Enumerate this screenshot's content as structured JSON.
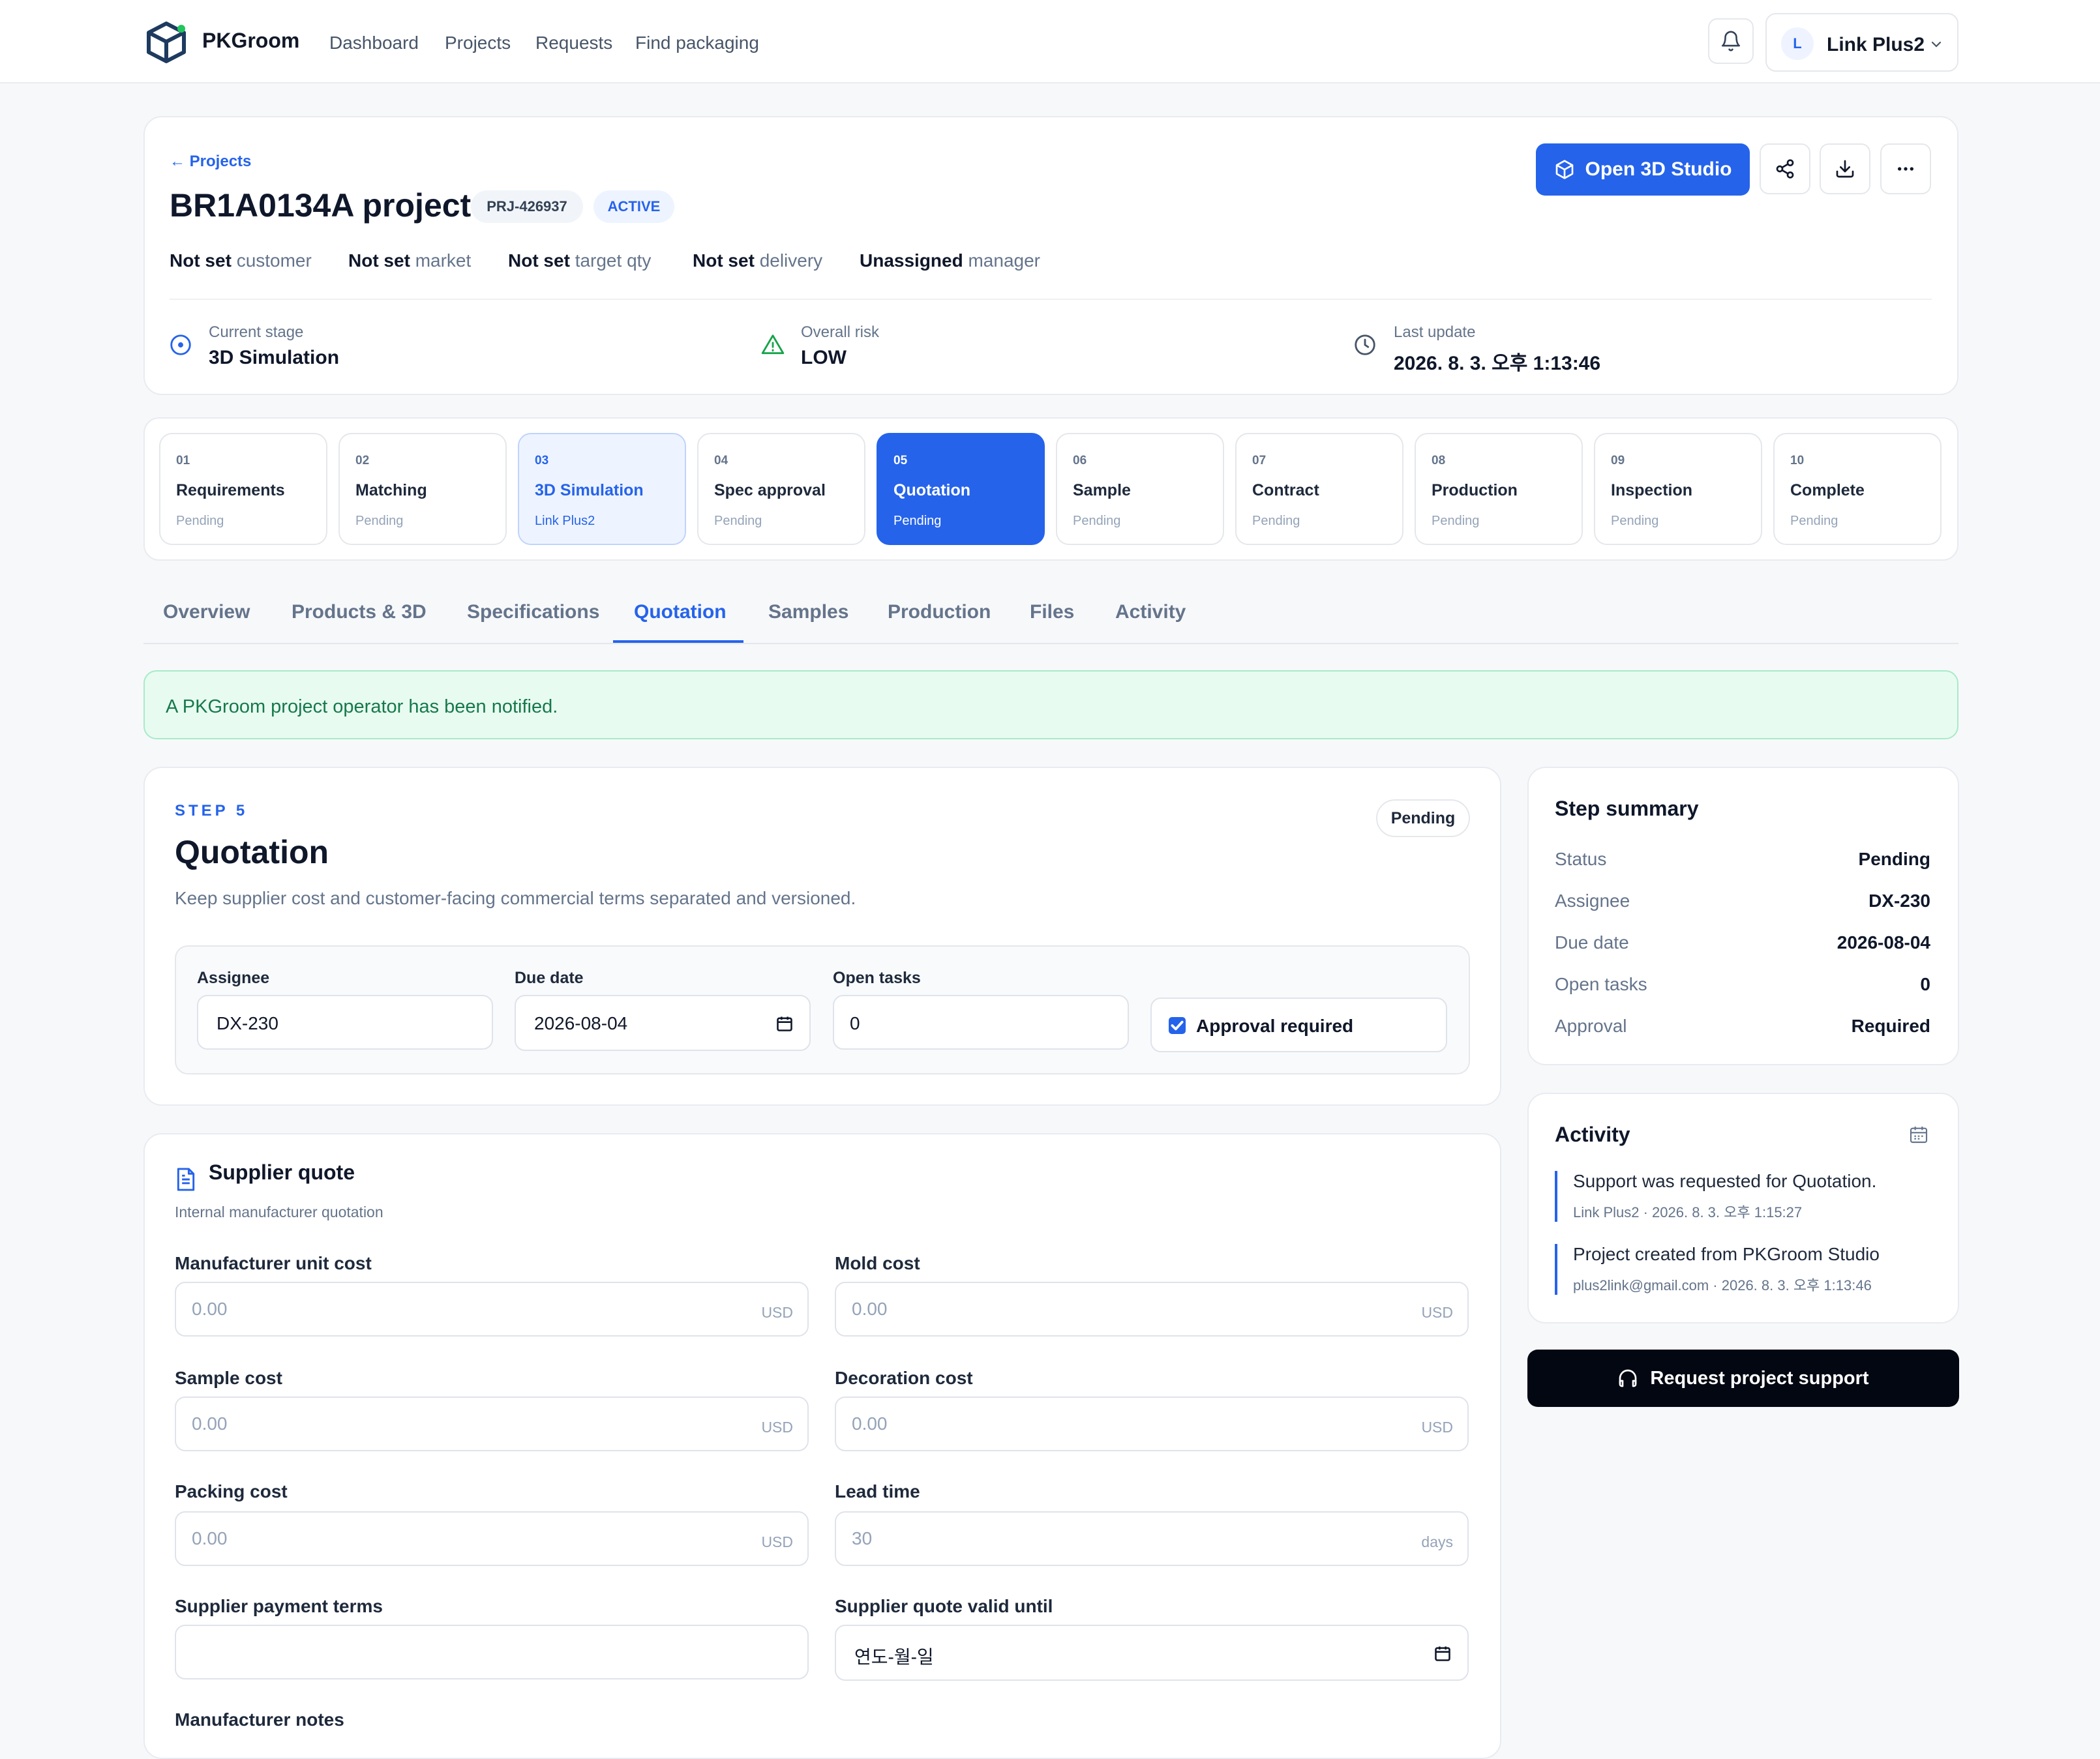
{
  "app": {
    "brand": "PKGroom"
  },
  "nav": {
    "items": [
      "Dashboard",
      "Projects",
      "Requests",
      "Find packaging"
    ]
  },
  "user": {
    "initial": "L",
    "name": "Link Plus2"
  },
  "project": {
    "back_label": "← Projects",
    "title": "BR1A0134A project",
    "code": "PRJ-426937",
    "status": "ACTIVE",
    "open_studio_label": "Open 3D Studio",
    "meta": [
      {
        "value": "Not set",
        "label": "customer"
      },
      {
        "value": "Not set",
        "label": "market"
      },
      {
        "value": "Not set",
        "label": "target qty"
      },
      {
        "value": "Not set",
        "label": "delivery"
      },
      {
        "value": "Unassigned",
        "label": "manager"
      }
    ],
    "stats": [
      {
        "label": "Current stage",
        "value": "3D Simulation"
      },
      {
        "label": "Overall risk",
        "value": "LOW"
      },
      {
        "label": "Last update",
        "value": "2026. 8. 3. 오후 1:13:46"
      }
    ]
  },
  "steps": [
    {
      "num": "01",
      "title": "Requirements",
      "status": "Pending"
    },
    {
      "num": "02",
      "title": "Matching",
      "status": "Pending"
    },
    {
      "num": "03",
      "title": "3D Simulation",
      "status": "Link Plus2"
    },
    {
      "num": "04",
      "title": "Spec approval",
      "status": "Pending"
    },
    {
      "num": "05",
      "title": "Quotation",
      "status": "Pending"
    },
    {
      "num": "06",
      "title": "Sample",
      "status": "Pending"
    },
    {
      "num": "07",
      "title": "Contract",
      "status": "Pending"
    },
    {
      "num": "08",
      "title": "Production",
      "status": "Pending"
    },
    {
      "num": "09",
      "title": "Inspection",
      "status": "Pending"
    },
    {
      "num": "10",
      "title": "Complete",
      "status": "Pending"
    }
  ],
  "tabs": [
    "Overview",
    "Products & 3D",
    "Specifications",
    "Quotation",
    "Samples",
    "Production",
    "Files",
    "Activity"
  ],
  "alert": "A PKGroom project operator has been notified.",
  "step_panel": {
    "eyebrow": "STEP 5",
    "title": "Quotation",
    "status": "Pending",
    "description": "Keep supplier cost and customer-facing commercial terms separated and versioned.",
    "assignee_label": "Assignee",
    "assignee": "DX-230",
    "due_label": "Due date",
    "due": "2026-08-04",
    "tasks_label": "Open tasks",
    "tasks": "0",
    "approval_label": "Approval required",
    "approval_checked": true
  },
  "supplier": {
    "title": "Supplier quote",
    "subtitle": "Internal manufacturer quotation",
    "fields": [
      {
        "label": "Manufacturer unit cost",
        "placeholder": "0.00",
        "unit": "USD"
      },
      {
        "label": "Mold cost",
        "placeholder": "0.00",
        "unit": "USD"
      },
      {
        "label": "Sample cost",
        "placeholder": "0.00",
        "unit": "USD"
      },
      {
        "label": "Decoration cost",
        "placeholder": "0.00",
        "unit": "USD"
      },
      {
        "label": "Packing cost",
        "placeholder": "0.00",
        "unit": "USD"
      },
      {
        "label": "Lead time",
        "placeholder": "30",
        "unit": "days"
      },
      {
        "label": "Supplier payment terms",
        "placeholder": "",
        "unit": ""
      },
      {
        "label": "Supplier quote valid until",
        "placeholder": "연도-월-일",
        "unit": ""
      }
    ],
    "notes_label": "Manufacturer notes"
  },
  "summary": {
    "title": "Step summary",
    "rows": [
      {
        "label": "Status",
        "value": "Pending"
      },
      {
        "label": "Assignee",
        "value": "DX-230"
      },
      {
        "label": "Due date",
        "value": "2026-08-04"
      },
      {
        "label": "Open tasks",
        "value": "0"
      },
      {
        "label": "Approval",
        "value": "Required"
      }
    ]
  },
  "activity": {
    "title": "Activity",
    "items": [
      {
        "text": "Support was requested for Quotation.",
        "meta": "Link Plus2 · 2026. 8. 3. 오후 1:15:27"
      },
      {
        "text": "Project created from PKGroom Studio",
        "meta": "plus2link@gmail.com · 2026. 8. 3. 오후 1:13:46"
      }
    ]
  },
  "support_button": "Request project support",
  "colors": {
    "accent": "#2563eb",
    "success_bg": "#e8fbf1",
    "success_text": "#16794a",
    "dark": "#030712"
  }
}
